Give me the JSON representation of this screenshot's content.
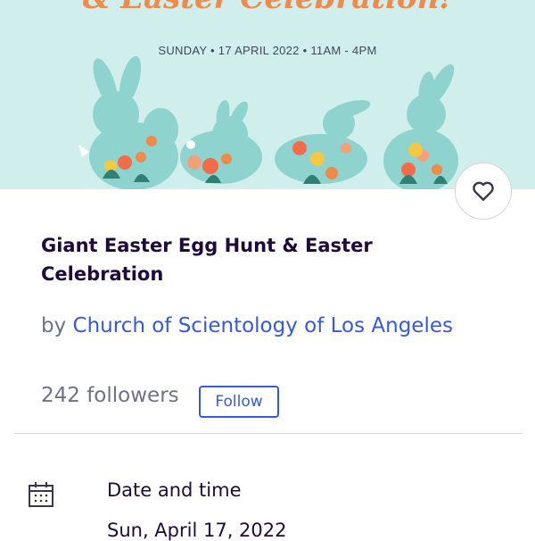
{
  "banner": {
    "title": "& Easter Celebration!",
    "date_line": "SUNDAY • 17 APRIL 2022 • 11AM - 4PM",
    "image_subject": "four-bunny-silhouettes-with-flowers"
  },
  "like_button": {
    "icon": "heart-icon"
  },
  "event": {
    "title": "Giant Easter Egg Hunt & Easter Celebration"
  },
  "organizer": {
    "prefix": "by",
    "name": "Church of Scientology of Los Angeles",
    "followers": "242 followers",
    "follow_label": "Follow"
  },
  "date_section": {
    "icon": "calendar-icon",
    "heading": "Date and time",
    "value": "Sun, April 17, 2022"
  },
  "colors": {
    "banner_bg": "#cfeeec",
    "bunny": "#8fd3cf",
    "accent_orange": "#f08a4b",
    "link_blue": "#3659e3",
    "title_dark": "#1e0a3c",
    "muted_text": "#6f7287"
  }
}
